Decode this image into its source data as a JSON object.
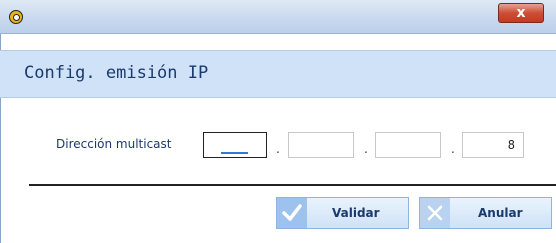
{
  "window": {
    "icon": "app-logo-icon",
    "close_icon": "close-icon",
    "close_label": "x",
    "close_color": "#c94a34"
  },
  "header": {
    "title": "Config. emisión IP",
    "background": "#cfe2f8"
  },
  "form": {
    "label": "Dirección multicast",
    "octets": [
      "",
      "",
      "",
      "8"
    ],
    "dots": [
      ".",
      ".",
      "."
    ]
  },
  "buttons": {
    "validate": {
      "label": "Validar",
      "icon": "check-icon"
    },
    "cancel": {
      "label": "Anular",
      "icon": "x-icon"
    }
  }
}
